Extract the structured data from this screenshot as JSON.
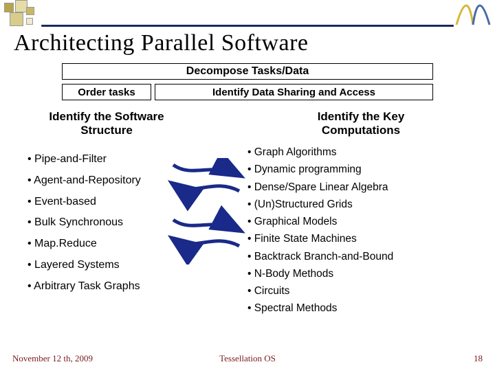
{
  "title": "Architecting Parallel Software",
  "boxes": {
    "decompose": "Decompose Tasks/Data",
    "order": "Order tasks",
    "identify": "Identify Data Sharing and Access"
  },
  "sublabels": {
    "left": "Identify the Software Structure",
    "right": "Identify the Key Computations"
  },
  "left_list": [
    "• Pipe-and-Filter",
    "• Agent-and-Repository",
    "• Event-based",
    "• Bulk Synchronous",
    "• Map.Reduce",
    "• Layered Systems",
    "• Arbitrary Task Graphs"
  ],
  "right_list": [
    "• Graph Algorithms",
    "• Dynamic programming",
    "• Dense/Spare Linear Algebra",
    "• (Un)Structured Grids",
    "• Graphical Models",
    "• Finite State Machines",
    "• Backtrack Branch-and-Bound",
    "• N-Body Methods",
    "• Circuits",
    "• Spectral Methods"
  ],
  "footer": {
    "left": "November 12 th, 2009",
    "center": "Tessellation OS",
    "right": "18"
  }
}
